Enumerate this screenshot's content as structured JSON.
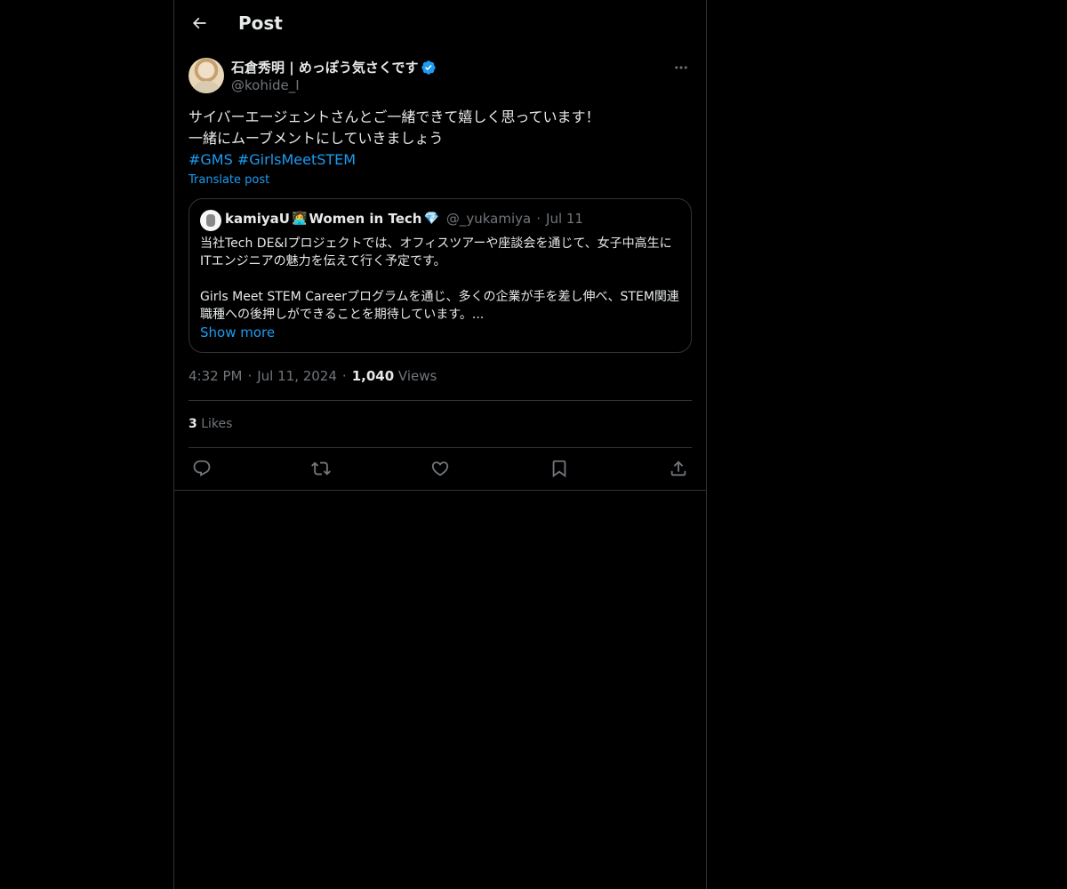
{
  "header": {
    "title": "Post"
  },
  "post": {
    "author_name": "石倉秀明 | めっぽう気さくです",
    "author_handle": "@kohide_I",
    "text_lines": [
      "サイバーエージェントさんとご一緒できて嬉しく思っています！",
      "一緒にムーブメントにしていきましょう"
    ],
    "hashtags": [
      "#GMS",
      "#GirlsMeetSTEM"
    ],
    "translate_label": "Translate post",
    "time": "4:32 PM",
    "date": "Jul 11, 2024",
    "views_count": "1,040",
    "views_label": "Views",
    "likes_count": "3",
    "likes_label": "Likes"
  },
  "quote": {
    "name": "kamiyaU",
    "emoji1": "👩‍💻",
    "name_suffix": "Women in Tech",
    "emoji2": "💎",
    "handle": "@_yukamiya",
    "date": "Jul 11",
    "para1": "当社Tech DE&Iプロジェクトでは、オフィスツアーや座談会を通じて、女子中高生にITエンジニアの魅力を伝えて行く予定です。",
    "para2": "Girls Meet STEM Careerプログラムを通じ、多くの企業が手を差し伸べ、STEM関連職種への後押しができることを期待しています。...",
    "show_more_label": "Show more"
  },
  "icons": {
    "back": "arrow-left-icon",
    "more": "more-horizontal-icon",
    "verified": "verified-badge-icon",
    "reply": "reply-icon",
    "repost": "repost-icon",
    "like": "heart-icon",
    "bookmark": "bookmark-icon",
    "share": "share-icon"
  },
  "colors": {
    "background": "#000000",
    "text": "#e7e9ea",
    "secondary_text": "#71767b",
    "accent": "#1d9bf0",
    "border": "#2f3336"
  }
}
